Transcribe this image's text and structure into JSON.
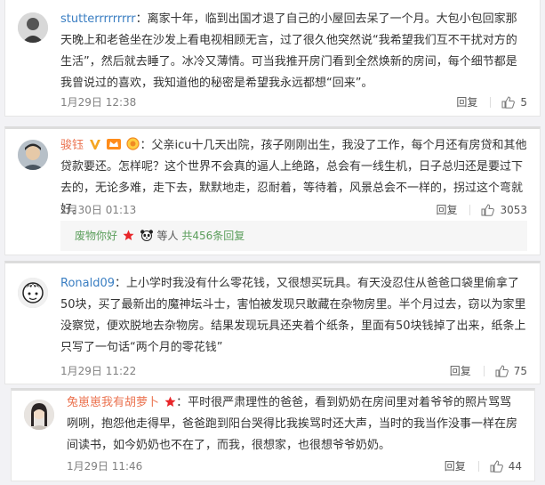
{
  "comments": [
    {
      "username": "stutterrrrrrrrr",
      "separator": "：",
      "text": "离家十年，临到出国才退了自己的小屋回去呆了一个月。大包小包回家那天晚上和老爸坐在沙发上看电视相顾无言，过了很久他突然说“我希望我们互不干扰对方的生活”，然后就去睡了。冰冷又薄情。可当我推开房门看到全然焕新的房间，每个细节都是我曾说过的喜欢，我知道他的秘密是希望我永远都想“回来”。",
      "time": "1月29日 12:38",
      "reply_label": "回复",
      "likes": "5"
    },
    {
      "username": "骏钰",
      "separator": "：",
      "text": "父亲icu十几天出院，孩子刚刚出生，我没了工作，每个月还有房贷和其他贷款要还。怎样呢？这个世界不会真的逼人上绝路，总会有一线生机，日子总归还是要过下去的，无论多难，走下去，默默地走，忍耐着，等待着，风景总会不一样的，拐过这个弯就好。",
      "time": "1月30日 01:13",
      "reply_label": "回复",
      "likes": "3053",
      "sub_reply": {
        "user": "废物你好",
        "middle": "等人",
        "link": "共456条回复"
      }
    },
    {
      "username": "Ronald09",
      "separator": "：",
      "text": "上小学时我没有什么零花钱，又很想买玩具。有天没忍住从爸爸口袋里偷拿了50块，买了最新出的魔神坛斗士，害怕被发现只敢藏在杂物房里。半个月过去，窃以为家里没察觉，便欢脱地去杂物房。结果发现玩具还夹着个纸条，里面有50块钱掉了出来，纸条上只写了一句话“两个月的零花钱”",
      "time": "1月29日 11:22",
      "reply_label": "回复",
      "likes": "75"
    },
    {
      "username": "兔崽崽我有胡萝卜",
      "separator": "：",
      "text": "平时很严肃理性的爸爸，看到奶奶在房间里对着爷爷的照片骂骂咧咧，抱怨他走得早，爸爸跑到阳台哭得比我挨骂时还大声，当时的我当作没事一样在房间读书，如今奶奶也不在了，而我，很想家，也很想爷爷奶奶。",
      "time": "1月29日 11:46",
      "reply_label": "回复",
      "likes": "44"
    }
  ],
  "colors": {
    "orange_name": "#eb7350",
    "blue_name": "#3a7ec2",
    "green_link": "#5b9e5b"
  },
  "icons": [
    "thumbs-up-icon",
    "vip-v-icon",
    "crown-icon",
    "star-icon",
    "panda-icon"
  ]
}
